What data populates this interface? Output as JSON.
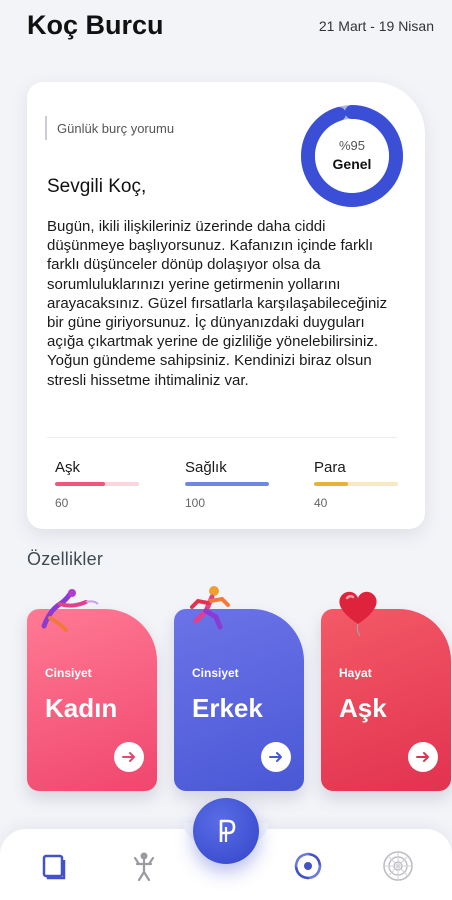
{
  "header": {
    "title": "Koç Burcu",
    "date_range": "21 Mart - 19 Nisan"
  },
  "daily": {
    "subtitle": "Günlük burç yorumu",
    "overall_percent_label": "%95",
    "overall_percent": 95,
    "overall_label": "Genel",
    "greeting": "Sevgili Koç,",
    "text": "Bugün, ikili ilişkileriniz üzerinde daha ciddi düşünmeye başlıyorsunuz. Kafanızın içinde farklı farklı düşünceler dönüp dolaşıyor olsa da sorumluluklarınızı yerine getirmenin yollarını arayacaksınız. Güzel fırsatlarla karşılaşabileceğiniz bir güne giriyorsunuz. İç dünyanızdaki duyguları açığa çıkartmak yerine de gizliliğe yönelebilirsiniz. Yoğun gündeme sahipsiniz. Kendinizi biraz olsun stresli hissetme ihtimaliniz var.",
    "stats": [
      {
        "name": "Aşk",
        "value": "60",
        "fraction": 0.6,
        "color": "#f0557a",
        "track": "#fbd5de"
      },
      {
        "name": "Sağlık",
        "value": "100",
        "fraction": 1.0,
        "color": "#6f86e3",
        "track": "#d6ddf6"
      },
      {
        "name": "Para",
        "value": "40",
        "fraction": 0.4,
        "color": "#e8b23a",
        "track": "#f8e8c4"
      }
    ]
  },
  "features": {
    "title": "Özellikler",
    "cards": [
      {
        "category": "Cinsiyet",
        "value": "Kadın",
        "icon": "dancer-icon",
        "gradient": [
          "#ff7a94",
          "#f0466e"
        ]
      },
      {
        "category": "Cinsiyet",
        "value": "Erkek",
        "icon": "runner-icon",
        "gradient": [
          "#6c73e8",
          "#4a58d6"
        ]
      },
      {
        "category": "Hayat",
        "value": "Aşk",
        "icon": "heart-balloon-icon",
        "gradient": [
          "#f35a66",
          "#e23250"
        ]
      }
    ]
  },
  "nav": {
    "items": [
      "book-icon",
      "zodiac-figure-icon",
      "vortex-icon",
      "mandala-icon"
    ],
    "center_icon": "logo-p-icon"
  },
  "colors": {
    "accent": "#3345c9",
    "background": "#f3f4f8"
  }
}
